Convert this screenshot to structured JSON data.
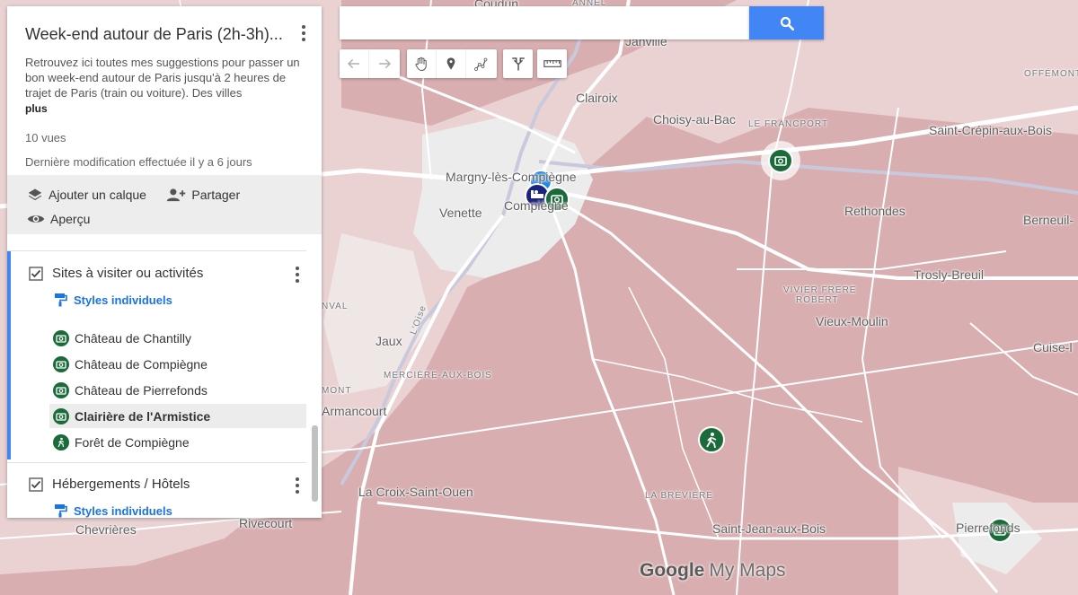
{
  "search": {
    "placeholder": "",
    "value": ""
  },
  "icons": {
    "search": "search-icon",
    "undo": "undo-icon",
    "redo": "redo-icon",
    "hand": "hand-pan-icon",
    "marker": "add-marker-icon",
    "line": "draw-line-icon",
    "directions": "directions-icon",
    "ruler": "ruler-icon"
  },
  "panel": {
    "title": "Week-end autour de Paris (2h-3h)...",
    "description": "Retrouvez ici toutes mes suggestions pour passer un bon week-end autour de Paris jusqu'à 2 heures de trajet de Paris (train ou voiture). Des villes",
    "more_label": "plus",
    "views": "10 vues",
    "modified": "Dernière modification effectuée il y a 6 jours",
    "actions": {
      "add_layer": "Ajouter un calque",
      "share": "Partager",
      "preview": "Aperçu"
    }
  },
  "layers": [
    {
      "name": "Sites à visiter ou activités",
      "styles_label": "Styles individuels",
      "items": [
        {
          "label": "Château de Chantilly",
          "icon": "camera-icon"
        },
        {
          "label": "Château de Compiègne",
          "icon": "camera-icon"
        },
        {
          "label": "Château de Pierrefonds",
          "icon": "camera-icon"
        },
        {
          "label": "Clairière de l'Armistice",
          "icon": "camera-icon",
          "selected": true
        },
        {
          "label": "Forêt de Compiègne",
          "icon": "hiking-icon"
        }
      ]
    },
    {
      "name": "Hébergements / Hôtels",
      "styles_label": "Styles individuels"
    }
  ],
  "map_labels": {
    "coudun": "Coudun",
    "annel": "ANNEL",
    "janville": "Janville",
    "offemont": "OFFÉMONT",
    "clairoix": "Clairoix",
    "choisy": "Choisy-au-Bac",
    "francport": "LE FRANCPORT",
    "saint_crepin": "Saint-Crépin-aux-Bois",
    "margny": "Margny-lès-Compiègne",
    "venette": "Venette",
    "compiegne": "Compiègne",
    "rethondes": "Rethondes",
    "berneuil": "Berneuil-",
    "trosly": "Trosly-Breuil",
    "vivier": "VIVIER FRÈRE",
    "robert": "ROBERT",
    "vieux_moulin": "Vieux-Moulin",
    "oise": "L'Oise",
    "nval": "NVAL",
    "jaux": "Jaux",
    "cuise": "Cuise-l",
    "mercière": "MERCIÈRE-AUX-BOIS",
    "mont": "MONT",
    "armancourt": "Armancourt",
    "la_croix": "La Croix-Saint-Ouen",
    "la_breviere": "LA BRÉVIÈRE",
    "saint_jean": "Saint-Jean-aux-Bois",
    "pierrefonds": "Pierrefonds",
    "rivecourt": "Rivecourt",
    "chevrieres": "Chevrières"
  },
  "logo": {
    "google": "Google",
    "mymaps": "My Maps"
  },
  "colors": {
    "forest": "#d9aeb0",
    "road": "#ffffff",
    "urban": "#ececec",
    "accent": "#4285f4",
    "marker_green": "#1b6b3a",
    "marker_navy": "#1a237e"
  }
}
